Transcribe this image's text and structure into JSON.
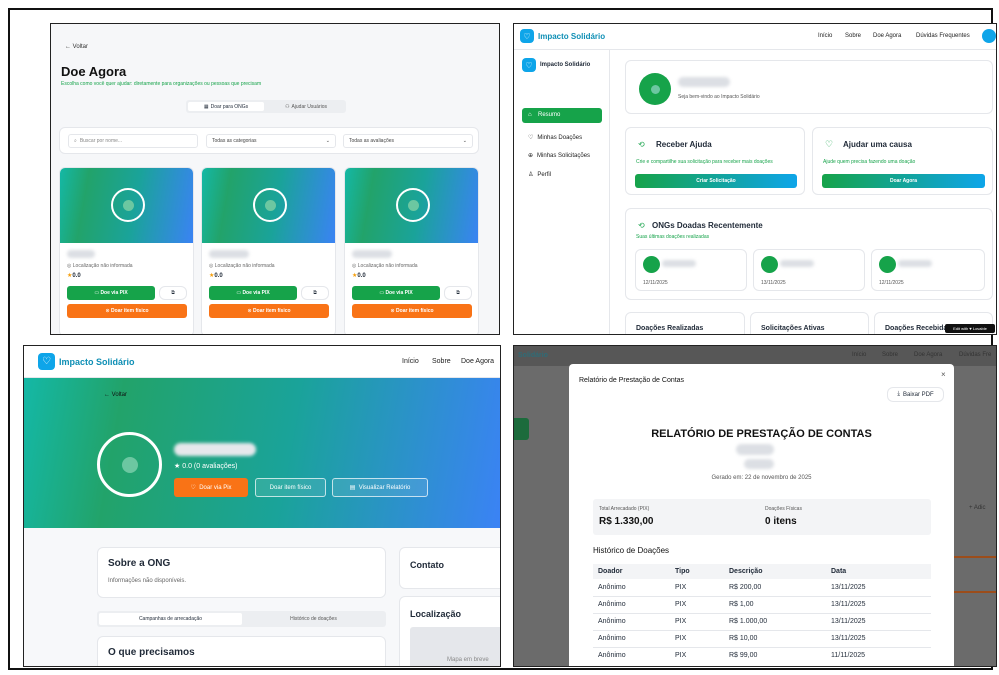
{
  "p1": {
    "back": "← Voltar",
    "title": "Doe Agora",
    "subtitle": "Escolha como você quer ajudar: diretamente para organizações ou pessoas que precisam",
    "tab_ngos": "Doar para ONGs",
    "tab_users": "Ajudar Usuários",
    "search_placeholder": "Buscar por nome...",
    "filter_categories": "Todas as categorias",
    "filter_ratings": "Todas as avaliações",
    "location": "Localização não informada",
    "rating": "0.0",
    "pix_btn": "Doe via PIX",
    "item_btn": "Doar item físico"
  },
  "p2": {
    "brand": "Impacto Solidário",
    "nav": [
      "Início",
      "Sobre",
      "Doe Agora",
      "Dúvidas Frequentes"
    ],
    "sidebar_title": "Impacto Solidário",
    "sidebar": [
      "Resumo",
      "Minhas Doações",
      "Minhas Solicitações",
      "Perfil"
    ],
    "welcome": "Seja bem-vindo ao Impacto Solidário",
    "receive_title": "Receber Ajuda",
    "receive_desc": "Crie e compartilhe sua solicitação para receber mais doações",
    "receive_btn": "Criar Solicitação",
    "help_title": "Ajudar uma causa",
    "help_desc": "Ajude quem precisa fazendo uma doação",
    "help_btn": "Doar Agora",
    "recent_title": "ONGs Doadas Recentemente",
    "recent_desc": "Suas últimas doações realizadas",
    "recent_dates": [
      "12/11/2025",
      "13/11/2025",
      "12/11/2025"
    ],
    "stats": [
      "Doações Realizadas",
      "Solicitações Ativas",
      "Doações Recebidas"
    ],
    "badge": "Edit with ♥ Lovable"
  },
  "p3": {
    "brand": "Impacto Solidário",
    "nav": [
      "Início",
      "Sobre",
      "Doe Agora"
    ],
    "back": "← Voltar",
    "rating": "0.0 (0 avaliações)",
    "pix_btn": "Doar via Pix",
    "item_btn": "Doar item físico",
    "report_btn": "Visualizar Relatório",
    "about_title": "Sobre a ONG",
    "about_desc": "Informações não disponíveis.",
    "contact_title": "Contato",
    "tab_campaigns": "Campanhas de arrecadação",
    "tab_history": "Histórico de doações",
    "location_title": "Localização",
    "needs_title": "O que precisamos",
    "map_text": "Mapa em breve"
  },
  "p4": {
    "bg_brand": "Solidário",
    "bg_nav": [
      "Início",
      "Sobre",
      "Doe Agora",
      "Dúvidas Fre"
    ],
    "bg_add": "+ Adic",
    "modal_title": "Relatório de Prestação de Contas",
    "download_btn": "Baixar PDF",
    "report_title": "RELATÓRIO DE PRESTAÇÃO DE CONTAS",
    "generated": "Gerado em: 22 de novembro de 2025",
    "total_label": "Total Arrecadado (PIX)",
    "total_value": "R$ 1.330,00",
    "physical_label": "Doações Físicas",
    "physical_value": "0 itens",
    "history_title": "Histórico de Doações",
    "columns": [
      "Doador",
      "Tipo",
      "Descrição",
      "Data"
    ],
    "rows": [
      [
        "Anônimo",
        "PIX",
        "R$ 200,00",
        "13/11/2025"
      ],
      [
        "Anônimo",
        "PIX",
        "R$ 1,00",
        "13/11/2025"
      ],
      [
        "Anônimo",
        "PIX",
        "R$ 1.000,00",
        "13/11/2025"
      ],
      [
        "Anônimo",
        "PIX",
        "R$ 10,00",
        "13/11/2025"
      ],
      [
        "Anônimo",
        "PIX",
        "R$ 99,00",
        "11/11/2025"
      ]
    ]
  },
  "colors": {
    "green": "#16a34a",
    "orange": "#f97316",
    "teal": "#14b8a6",
    "blue": "#3b82f6"
  }
}
